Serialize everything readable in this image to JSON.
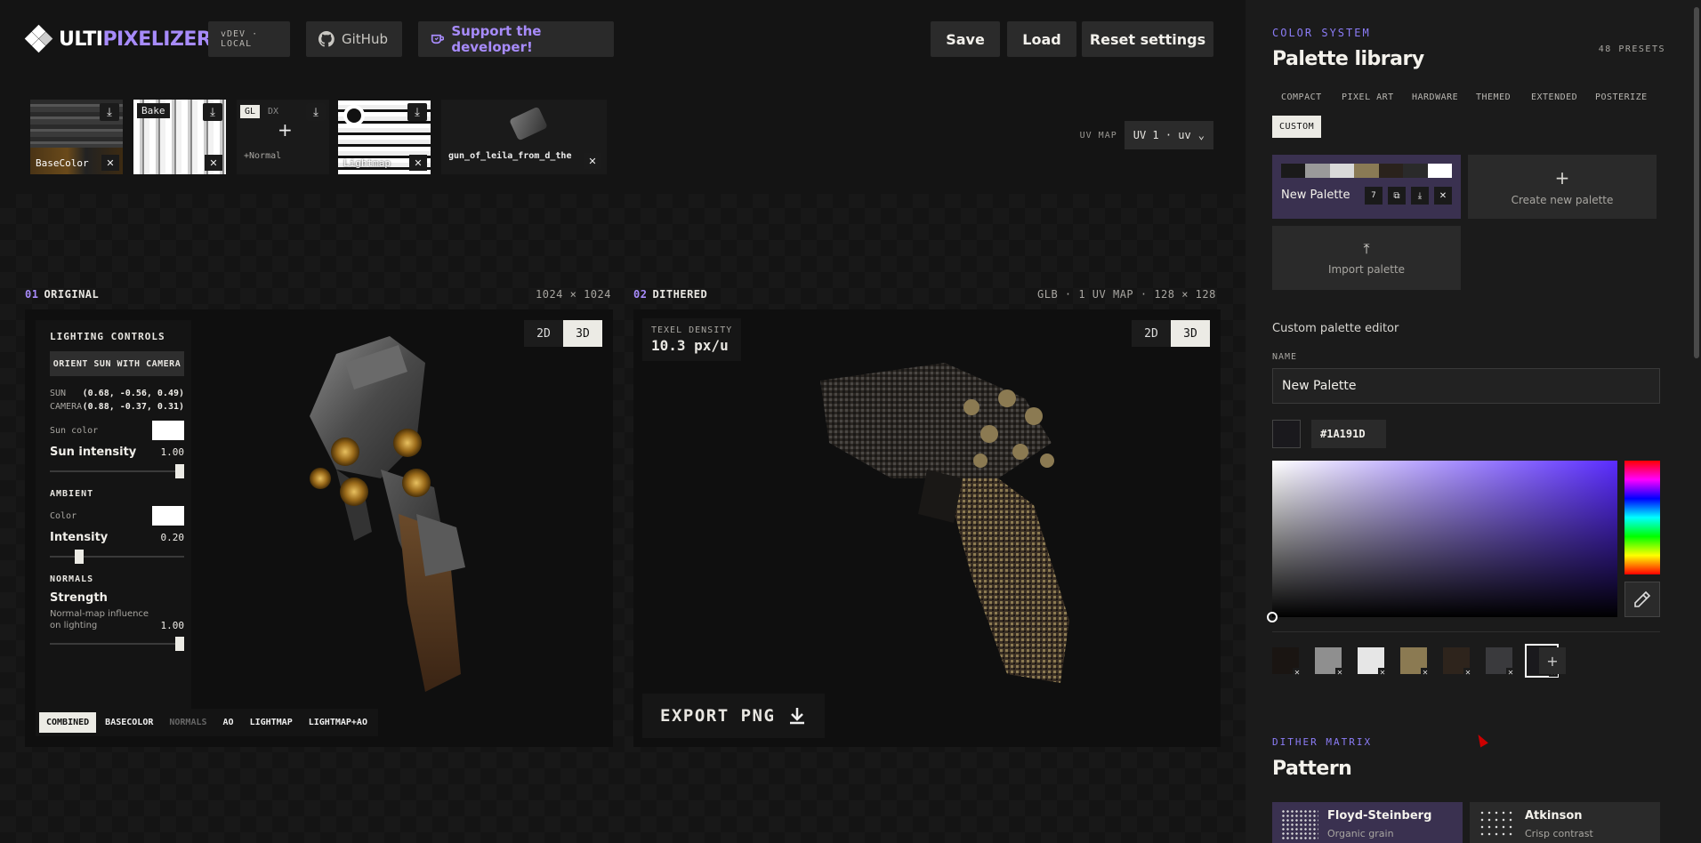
{
  "app": {
    "logo_part1": "ULTI",
    "logo_part2": "PIXELIZER",
    "version": "vDEV · LOCAL",
    "github_label": "GitHub",
    "support_label": "Support the developer!",
    "save_label": "Save",
    "load_label": "Load",
    "reset_label": "Reset settings"
  },
  "textures": {
    "base_label": "BaseColor",
    "bake_label": "Bake",
    "gl_label": "GL",
    "dx_label": "DX",
    "normal_label": "+Normal",
    "light_label": "Lightmap",
    "model_label": "gun_of_leila_from_d_the"
  },
  "uv": {
    "label": "UV MAP",
    "value": "UV 1 · uv"
  },
  "original": {
    "num": "01",
    "title": "ORIGINAL",
    "meta": "1024 × 1024",
    "toggle_2d": "2D",
    "toggle_3d": "3D"
  },
  "dithered": {
    "num": "02",
    "title": "DITHERED",
    "meta": "GLB · 1 UV MAP · 128 × 128",
    "toggle_2d": "2D",
    "toggle_3d": "3D",
    "texel_label": "TEXEL DENSITY",
    "texel_value": "10.3 px/u",
    "export_label": "EXPORT PNG"
  },
  "lighting": {
    "title": "LIGHTING CONTROLS",
    "orient": "ORIENT SUN WITH CAMERA",
    "sun_k": "SUN",
    "sun_v": "(0.68, -0.56, 0.49)",
    "cam_k": "CAMERA",
    "cam_v": "(0.88, -0.37, 0.31)",
    "sun_color": "Sun color",
    "sun_intensity": "Sun intensity",
    "sun_intensity_v": "1.00",
    "sun_intensity_level": 1.0,
    "ambient_title": "AMBIENT",
    "ambient_color": "Color",
    "intensity": "Intensity",
    "intensity_v": "0.20",
    "intensity_level": 0.2,
    "normals_title": "NORMALS",
    "strength": "Strength",
    "strength_desc": "Normal-map influence on lighting",
    "strength_v": "1.00",
    "strength_level": 1.0
  },
  "view_tabs": [
    "COMBINED",
    "BASECOLOR",
    "NORMALS",
    "AO",
    "LIGHTMAP",
    "LIGHTMAP+AO"
  ],
  "side": {
    "eyebrow": "COLOR SYSTEM",
    "title": "Palette library",
    "presets": "48 PRESETS",
    "categories": [
      "COMPACT",
      "PIXEL ART",
      "HARDWARE",
      "THEMED",
      "EXTENDED",
      "POSTERIZE",
      "CUSTOM"
    ],
    "palette_name": "New Palette",
    "palette_count": "7",
    "palette_colors": [
      "#1a1a1a",
      "#9a9a9a",
      "#d9d9d9",
      "#8a7a55",
      "#2a221c",
      "#2a2a2a",
      "#ffffff"
    ],
    "create_label": "Create new palette",
    "import_label": "Import palette",
    "editor_title": "Custom palette editor",
    "name_label": "NAME",
    "name_value": "New Palette",
    "hex_value": "#1A191D",
    "swatches": [
      "#1a1512",
      "#8f8f8f",
      "#e6e6e6",
      "#8b7a52",
      "#2e241c",
      "#3a3a3d",
      "#1a191d"
    ],
    "dither_eyebrow": "DITHER MATRIX",
    "dither_title": "Pattern",
    "dither_cards": [
      {
        "title": "Floyd-Steinberg",
        "sub": "Organic grain"
      },
      {
        "title": "Atkinson",
        "sub": "Crisp contrast"
      }
    ]
  },
  "colors": {
    "accent": "#a78bfa",
    "selected_card": "#3a3150"
  }
}
